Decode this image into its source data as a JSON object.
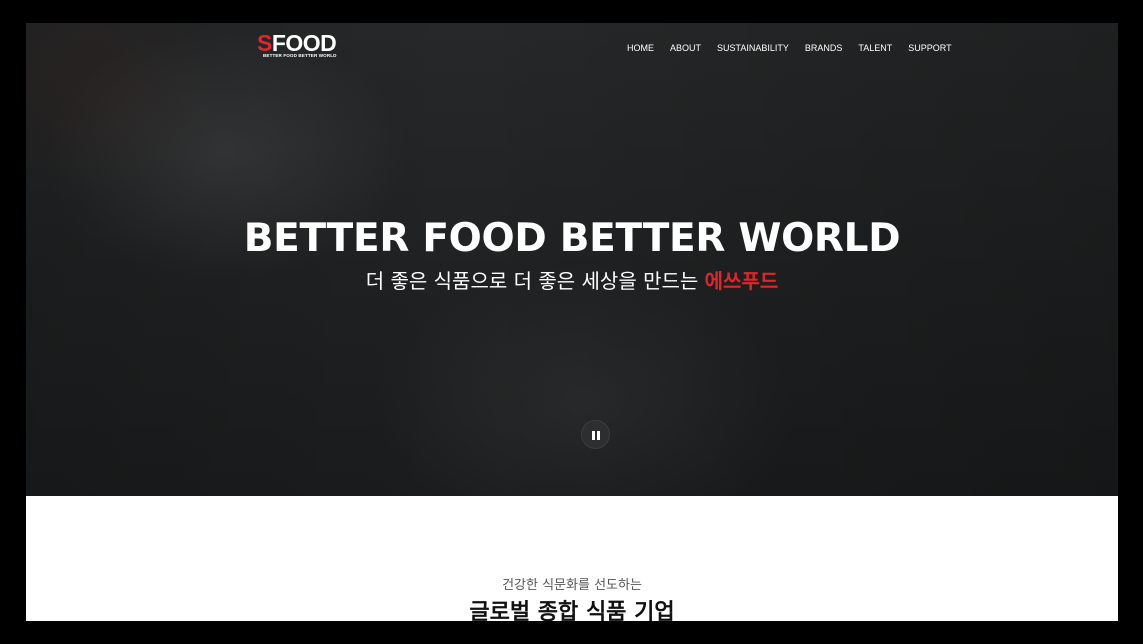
{
  "header": {
    "logo_text": "FOOD",
    "logo_s": "S",
    "logo_tagline": "BETTER FOOD BETTER WORLD",
    "nav": [
      "HOME",
      "ABOUT",
      "SUSTAINABILITY",
      "BRANDS",
      "TALENT",
      "SUPPORT"
    ]
  },
  "hero": {
    "title": "BETTER FOOD BETTER WORLD",
    "subtitle_prefix": "더 좋은 식품으로 더 좋은 세상을 만드는 ",
    "subtitle_accent": "에쓰푸드",
    "pause_icon": "pause-icon"
  },
  "intro": {
    "kicker": "건강한 식문화를 선도하는",
    "heading": "글로벌 종합 식품 기업"
  },
  "colors": {
    "accent": "#e0262b",
    "hero_bg": "#232526",
    "frame": "#000000"
  }
}
